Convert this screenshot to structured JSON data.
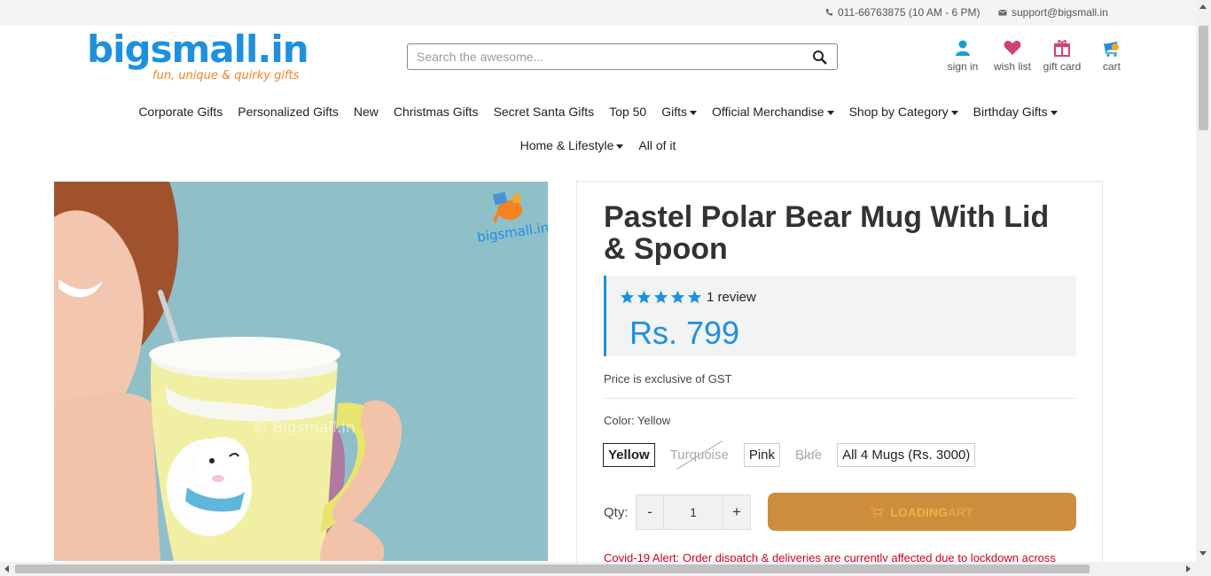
{
  "topbar": {
    "phone": "011-66763875 (10 AM - 6 PM)",
    "email": "support@bigsmall.in"
  },
  "logo": {
    "wordmark": "bigsmall.in",
    "tagline": "fun, unique & quirky gifts"
  },
  "search": {
    "placeholder": "Search the awesome..."
  },
  "header_icons": [
    {
      "label": "sign in",
      "icon": "user-icon",
      "color": "#1aa1c9"
    },
    {
      "label": "wish list",
      "icon": "heart-icon",
      "color": "#d2426e"
    },
    {
      "label": "gift card",
      "icon": "gift-icon",
      "color": "#d2426e"
    },
    {
      "label": "cart",
      "icon": "cart-icon",
      "color": "#1e90e0"
    }
  ],
  "nav": {
    "row1": [
      {
        "label": "Corporate Gifts",
        "dropdown": false
      },
      {
        "label": "Personalized Gifts",
        "dropdown": false
      },
      {
        "label": "New",
        "dropdown": false
      },
      {
        "label": "Christmas Gifts",
        "dropdown": false
      },
      {
        "label": "Secret Santa Gifts",
        "dropdown": false
      },
      {
        "label": "Top 50",
        "dropdown": false
      },
      {
        "label": "Gifts",
        "dropdown": true
      },
      {
        "label": "Official Merchandise",
        "dropdown": true
      },
      {
        "label": "Shop by Category",
        "dropdown": true
      },
      {
        "label": "Birthday Gifts",
        "dropdown": true
      }
    ],
    "row2": [
      {
        "label": "Home & Lifestyle",
        "dropdown": true
      },
      {
        "label": "All of it",
        "dropdown": false
      }
    ]
  },
  "product": {
    "image_watermark": "bigsmall.in",
    "image_center_watermark": "© Bigsmall.in",
    "title": "Pastel Polar Bear Mug With Lid & Spoon",
    "rating_stars": 5,
    "reviews": "1 review",
    "price": "Rs. 799",
    "gst_note": "Price is exclusive of GST",
    "color_label": "Color: Yellow",
    "variants": [
      {
        "label": "Yellow",
        "state": "selected"
      },
      {
        "label": "Turquoise",
        "state": "disabled"
      },
      {
        "label": "Pink",
        "state": "available"
      },
      {
        "label": "Blue",
        "state": "disabled"
      },
      {
        "label": "All 4 Mugs (Rs. 3000)",
        "state": "available"
      }
    ],
    "qty_label": "Qty:",
    "qty_minus": "-",
    "qty_value": "1",
    "qty_plus": "+",
    "add_to_cart_button": "LOADING",
    "add_to_cart_ghost": "ART",
    "covid_alert": "Covid-19 Alert: Order dispatch & deliveries are currently affected due to lockdown across"
  },
  "colors": {
    "brand_blue": "#1e90e0",
    "brand_orange": "#f58220",
    "cart_button": "#cc8e3d",
    "alert_red": "#d0021b"
  }
}
